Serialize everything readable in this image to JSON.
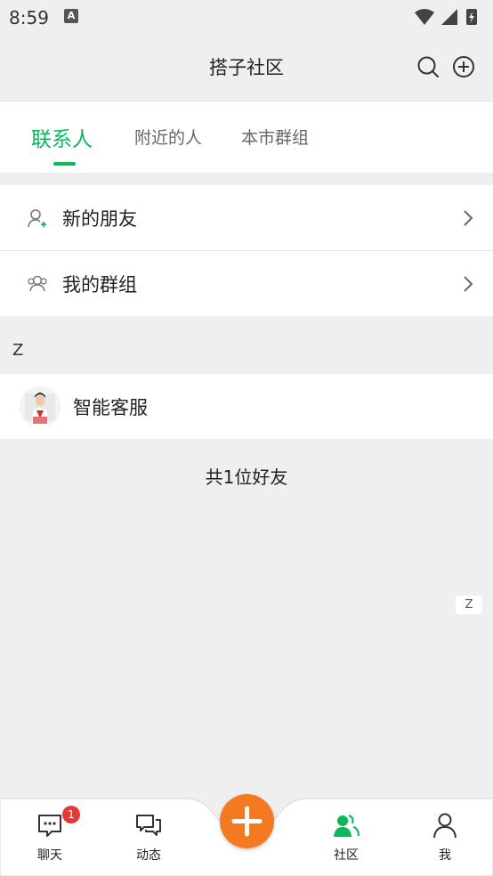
{
  "status_bar": {
    "time": "8:59",
    "notification_letter": "A"
  },
  "header": {
    "title": "搭子社区",
    "search_icon": "search-icon",
    "add_icon": "add-circle-icon"
  },
  "tabs": [
    {
      "label": "联系人",
      "active": true
    },
    {
      "label": "附近的人",
      "active": false
    },
    {
      "label": "本市群组",
      "active": false
    }
  ],
  "menu": [
    {
      "label": "新的朋友",
      "icon": "add-person-icon"
    },
    {
      "label": "我的群组",
      "icon": "group-icon"
    }
  ],
  "contacts": {
    "section_letter": "Z",
    "items": [
      {
        "name": "智能客服",
        "icon": "avatar"
      }
    ],
    "count_text": "共1位好友",
    "index_letter": "Z"
  },
  "bottom_nav": {
    "items": [
      {
        "label": "聊天",
        "icon": "chat-icon",
        "badge": "1",
        "active": false
      },
      {
        "label": "动态",
        "icon": "moments-icon",
        "active": false
      },
      {
        "label": "社区",
        "icon": "community-icon",
        "active": true
      },
      {
        "label": "我",
        "icon": "person-icon",
        "active": false
      }
    ],
    "fab_icon": "plus-icon"
  },
  "colors": {
    "accent": "#09b85a",
    "fab": "#f47a22",
    "badge": "#e53935",
    "background": "#efefef"
  }
}
